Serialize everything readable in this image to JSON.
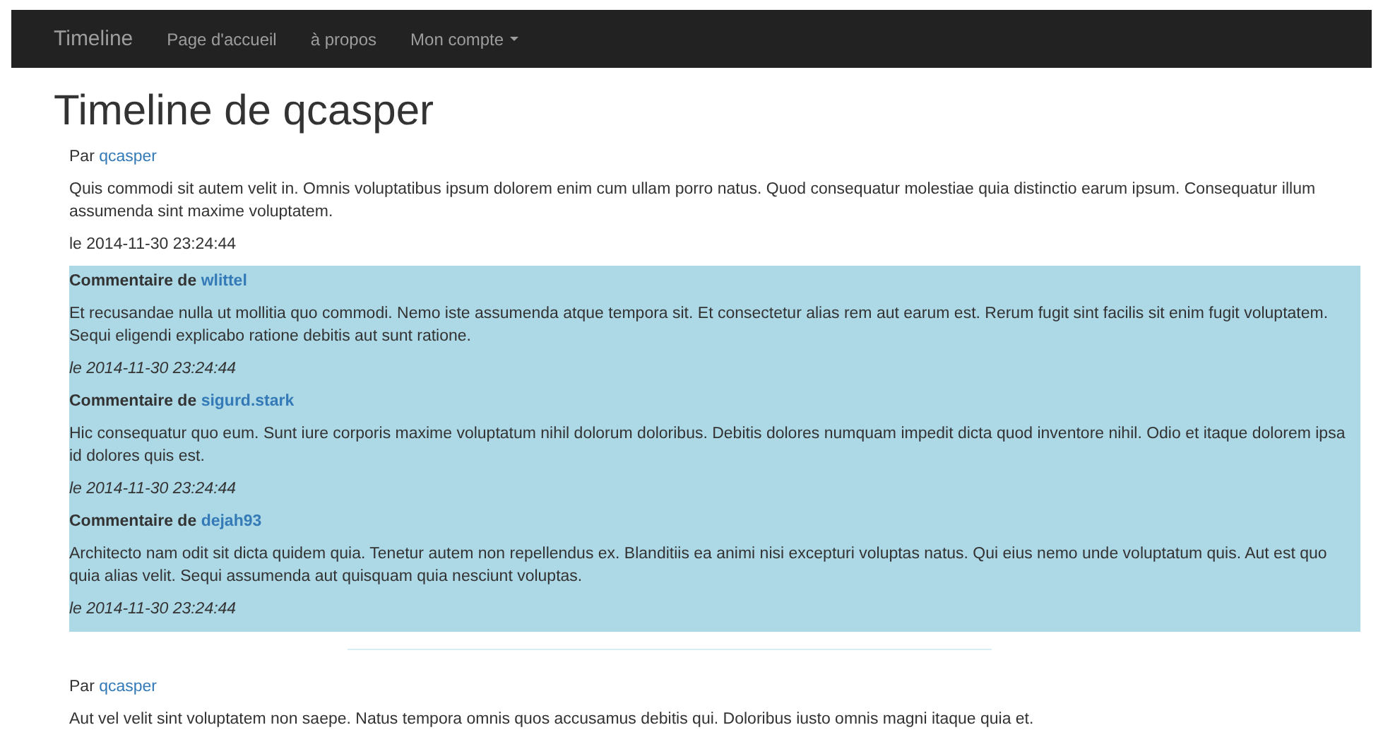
{
  "navbar": {
    "brand": "Timeline",
    "items": [
      {
        "label": "Page d'accueil",
        "kind": "link"
      },
      {
        "label": "à propos",
        "kind": "link"
      },
      {
        "label": "Mon compte",
        "kind": "dropdown"
      }
    ]
  },
  "page_title": "Timeline de qcasper",
  "posts": [
    {
      "by": "Par",
      "author": "qcasper",
      "body": "Quis commodi sit autem velit in. Omnis voluptatibus ipsum dolorem enim cum ullam porro natus. Quod consequatur molestiae quia distinctio earum ipsum. Consequatur illum assumenda sint maxime voluptatem.",
      "date": "le 2014-11-30 23:24:44",
      "comments": [
        {
          "by": "Commentaire de",
          "author": "wlittel",
          "body": "Et recusandae nulla ut mollitia quo commodi. Nemo iste assumenda atque tempora sit. Et consectetur alias rem aut earum est. Rerum fugit sint facilis sit enim fugit voluptatem. Sequi eligendi explicabo ratione debitis aut sunt ratione.",
          "date": "le 2014-11-30 23:24:44"
        },
        {
          "by": "Commentaire de",
          "author": "sigurd.stark",
          "body": "Hic consequatur quo eum. Sunt iure corporis maxime voluptatum nihil dolorum doloribus. Debitis dolores numquam impedit dicta quod inventore nihil. Odio et itaque dolorem ipsa id dolores quis est.",
          "date": "le 2014-11-30 23:24:44"
        },
        {
          "by": "Commentaire de",
          "author": "dejah93",
          "body": "Architecto nam odit sit dicta quidem quia. Tenetur autem non repellendus ex. Blanditiis ea animi nisi excepturi voluptas natus. Qui eius nemo unde voluptatum quis. Aut est quo quia alias velit. Sequi assumenda aut quisquam quia nesciunt voluptas.",
          "date": "le 2014-11-30 23:24:44"
        }
      ]
    },
    {
      "by": "Par",
      "author": "qcasper",
      "body": "Aut vel velit sint voluptatem non saepe. Natus tempora omnis quos accusamus debitis qui. Doloribus iusto omnis magni itaque quia et."
    }
  ]
}
